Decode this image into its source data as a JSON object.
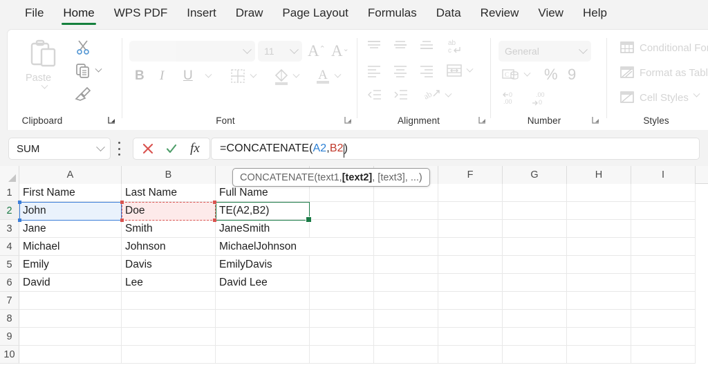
{
  "tabs": [
    {
      "label": "File",
      "active": false
    },
    {
      "label": "Home",
      "active": true
    },
    {
      "label": "WPS PDF",
      "active": false
    },
    {
      "label": "Insert",
      "active": false
    },
    {
      "label": "Draw",
      "active": false
    },
    {
      "label": "Page Layout",
      "active": false
    },
    {
      "label": "Formulas",
      "active": false
    },
    {
      "label": "Data",
      "active": false
    },
    {
      "label": "Review",
      "active": false
    },
    {
      "label": "View",
      "active": false
    },
    {
      "label": "Help",
      "active": false
    }
  ],
  "ribbon": {
    "groups": {
      "clipboard": {
        "label": "Clipboard",
        "paste_label": "Paste"
      },
      "font": {
        "label": "Font",
        "font_name": "",
        "font_size": "11",
        "bold": "B",
        "italic": "I",
        "underline": "U"
      },
      "alignment": {
        "label": "Alignment"
      },
      "number": {
        "label": "Number",
        "format": "General",
        "percent": "%",
        "comma": "9"
      },
      "styles": {
        "label": "Styles",
        "items": [
          {
            "label": "Conditional For"
          },
          {
            "label": "Format as Table"
          },
          {
            "label": "Cell Styles"
          }
        ]
      }
    }
  },
  "formula_bar": {
    "name_box": "SUM",
    "cancel_icon": "x-icon",
    "confirm_icon": "check-icon",
    "function_icon": "fx-icon",
    "formula_prefix": "=CONCATENATE(",
    "formula_arg1": "A2",
    "formula_comma": ",",
    "formula_arg2": "B2",
    "formula_suffix": ")"
  },
  "tooltip": {
    "prefix": "CONCATENATE(text1, ",
    "bold": "[text2]",
    "suffix": ", [text3], ...)"
  },
  "grid": {
    "columns": [
      "A",
      "B",
      "C",
      "D",
      "E",
      "F",
      "G",
      "H",
      "I"
    ],
    "rows": [
      "1",
      "2",
      "3",
      "4",
      "5",
      "6",
      "7",
      "8",
      "9",
      "10"
    ],
    "active_row": "2",
    "cells": {
      "A1": "First Name",
      "B1": "Last Name",
      "C1": "Full Name",
      "A2": "John",
      "B2": "Doe",
      "C2": "TE(A2,B2)",
      "A3": "Jane",
      "B3": "Smith",
      "C3": "JaneSmith",
      "A4": "Michael",
      "B4": "Johnson",
      "C4": "MichaelJohnson",
      "A5": "Emily",
      "B5": "Davis",
      "C5": "EmilyDavis",
      "A6": "David",
      "B6": "Lee",
      "C6": "David Lee"
    }
  },
  "colors": {
    "accent_green": "#15803d",
    "active_cell": "#1a7a45",
    "ref1_blue": "#2b7fd4",
    "ref2_red": "#c0392b",
    "cancel_red": "#d9534f",
    "confirm_green": "#4f9e6a"
  }
}
